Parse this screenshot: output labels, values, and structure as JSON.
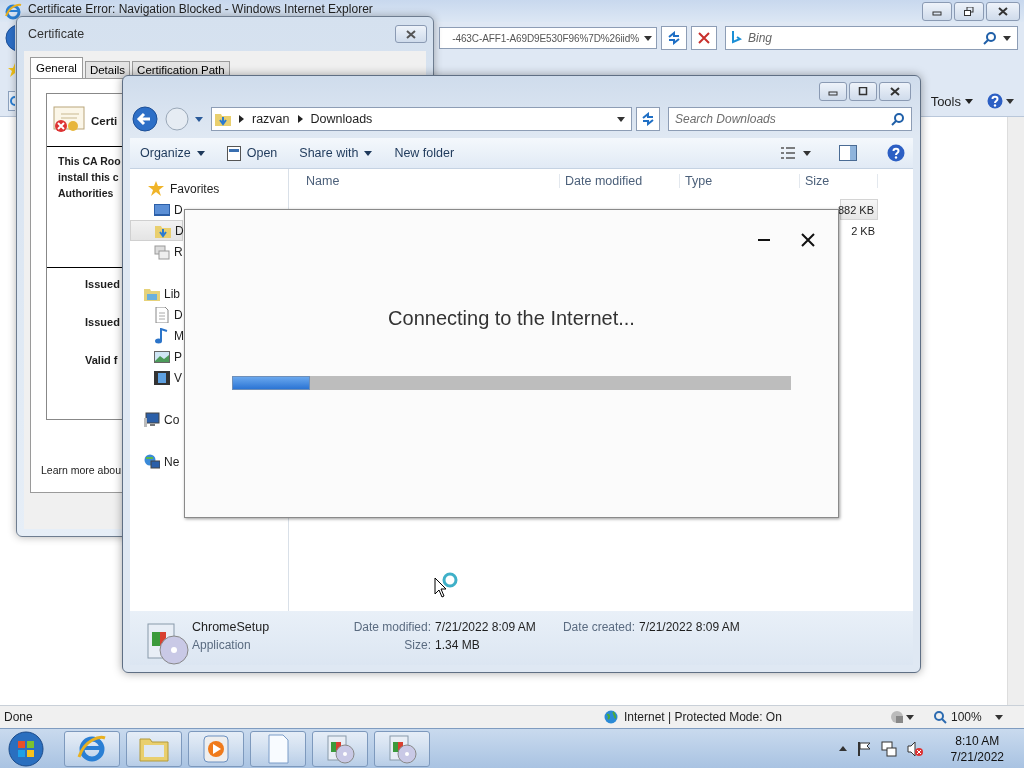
{
  "ie": {
    "title": "Certificate Error: Navigation Blocked - Windows Internet Explorer",
    "address": "-463C-AFF1-A69D9E530F96%7D%26iid%",
    "search_placeholder": "Bing",
    "tools_menu": "Tools",
    "status": "Done",
    "zone": "Internet | Protected Mode: On",
    "zoom": "100%"
  },
  "certificate": {
    "title": "Certificate",
    "tabs": [
      {
        "label": "General",
        "selected": true
      },
      {
        "label": "Details",
        "selected": false
      },
      {
        "label": "Certification Path",
        "selected": false
      }
    ],
    "heading": "Certi",
    "intro_lines": [
      "This CA Roo",
      "install this c",
      "Authorities"
    ],
    "fields": [
      "Issued",
      "Issued",
      "Valid f"
    ],
    "link": "Learn more abou"
  },
  "explorer": {
    "breadcrumb": [
      "razvan",
      "Downloads"
    ],
    "search_placeholder": "Search Downloads",
    "toolbar": [
      {
        "label": "Organize",
        "kind": "menu"
      },
      {
        "label": "Open",
        "kind": "open"
      },
      {
        "label": "Share with",
        "kind": "menu"
      },
      {
        "label": "New folder",
        "kind": "plain"
      }
    ],
    "nav": [
      {
        "label": "Favorites",
        "kind": "star",
        "selected": false,
        "children": [
          {
            "label": "D",
            "kind": "desktop",
            "selected": false
          },
          {
            "label": "D",
            "kind": "downloads",
            "selected": true
          },
          {
            "label": "R",
            "kind": "recent",
            "selected": false
          }
        ]
      },
      {
        "label": "Lib",
        "kind": "libraries",
        "selected": false,
        "children": [
          {
            "label": "D",
            "kind": "documents",
            "selected": false
          },
          {
            "label": "M",
            "kind": "music",
            "selected": false
          },
          {
            "label": "P",
            "kind": "pictures",
            "selected": false
          },
          {
            "label": "V",
            "kind": "videos",
            "selected": false
          }
        ]
      },
      {
        "label": "Co",
        "kind": "computer",
        "selected": false
      },
      {
        "label": "Ne",
        "kind": "network",
        "selected": false
      }
    ],
    "columns": [
      "Name",
      "Date modified",
      "Type",
      "Size"
    ],
    "rows": [
      {
        "size": "882 KB",
        "selected": true
      },
      {
        "size": "2 KB",
        "selected": false
      }
    ],
    "details": {
      "name": "ChromeSetup",
      "type": "Application",
      "fields": [
        {
          "label": "Date modified:",
          "value": "7/21/2022 8:09 AM"
        },
        {
          "label": "Size:",
          "value": "1.34 MB"
        },
        {
          "label": "Date created:",
          "value": "7/21/2022 8:09 AM"
        }
      ]
    }
  },
  "installer": {
    "message": "Connecting to the Internet...",
    "level": 0.14
  },
  "taskbar": {
    "apps": [
      {
        "kind": "browser"
      },
      {
        "kind": "folder"
      },
      {
        "kind": "media"
      },
      {
        "kind": "document"
      },
      {
        "kind": "installer"
      },
      {
        "kind": "installer"
      }
    ],
    "time": "8:10 AM",
    "date": "7/21/2022"
  }
}
